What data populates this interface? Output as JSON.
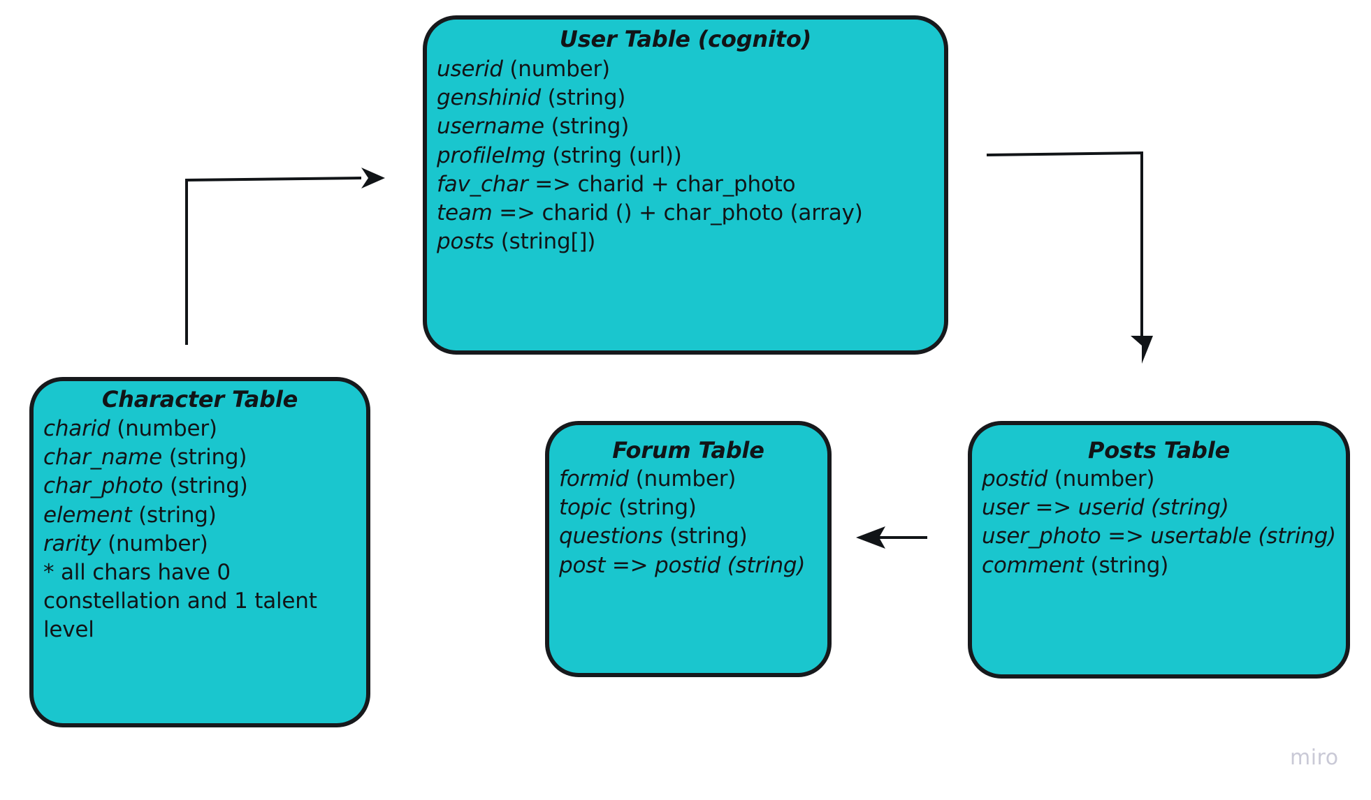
{
  "diagram": {
    "title": "Database schema relationship diagram",
    "colors": {
      "box_fill": "#1ac6ce",
      "box_border": "#17191c",
      "text": "#111417",
      "background": "#ffffff",
      "watermark": "#c9c9d6"
    },
    "watermark": "miro"
  },
  "tables": {
    "user": {
      "title": "User Table (cognito)",
      "fields": [
        {
          "name": "userid",
          "type": "(number)"
        },
        {
          "name": "genshinid",
          "type": "(string)"
        },
        {
          "name": "username",
          "type": "(string)"
        },
        {
          "name": "profileImg",
          "type": "(string (url))"
        },
        {
          "name": "fav_char",
          "type": "=> charid + char_photo"
        },
        {
          "name": "team",
          "type": "=> charid () + char_photo (array)"
        },
        {
          "name": "posts",
          "type": "(string[])"
        }
      ]
    },
    "character": {
      "title": "Character Table",
      "fields": [
        {
          "name": "charid",
          "type": "(number)"
        },
        {
          "name": "char_name",
          "type": "(string)"
        },
        {
          "name": "char_photo",
          "type": "(string)"
        },
        {
          "name": "element",
          "type": "(string)"
        },
        {
          "name": "rarity",
          "type": "(number)"
        }
      ],
      "note": "* all chars have 0 constellation and 1 talent level"
    },
    "forum": {
      "title": "Forum Table",
      "fields": [
        {
          "name": "formid",
          "type": "(number)"
        },
        {
          "name": "topic",
          "type": "(string)"
        },
        {
          "name": "questions",
          "type": "(string)"
        },
        {
          "name": "post",
          "type": "=> postid (string)"
        }
      ]
    },
    "posts": {
      "title": "Posts Table",
      "fields": [
        {
          "name": "postid",
          "type": "(number)"
        },
        {
          "name": "user",
          "type": "=> userid (string)"
        },
        {
          "name": "user_photo",
          "type": "=> usertable (string)"
        },
        {
          "name": "comment",
          "type": "(string)"
        }
      ]
    }
  },
  "connectors": [
    {
      "id": "character-to-user",
      "from": "Character Table",
      "to": "User Table (cognito)",
      "style": "elbow",
      "direction": "up-right"
    },
    {
      "id": "user-to-posts",
      "from": "User Table (cognito)",
      "to": "Posts Table",
      "style": "elbow",
      "direction": "right-down"
    },
    {
      "id": "posts-to-forum",
      "from": "Posts Table",
      "to": "Forum Table",
      "style": "straight",
      "direction": "left"
    }
  ]
}
